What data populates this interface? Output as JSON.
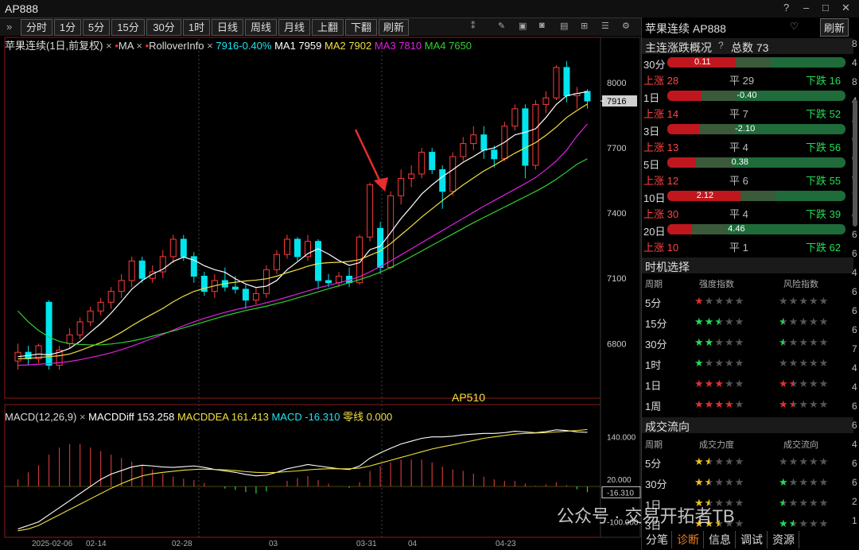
{
  "window": {
    "title": "AP888"
  },
  "toolbar": {
    "buttons": [
      "分时",
      "1分",
      "5分",
      "15分",
      "30分",
      "1时",
      "日线",
      "周线",
      "月线",
      "上翻",
      "下翻",
      "刷新"
    ]
  },
  "legend_main": {
    "name": "苹果连续(1日,前复权)",
    "ma_tag": "MA",
    "rollover_tag": "RolloverInfo",
    "price": "7916-0.40%",
    "ma1": "MA1 7959",
    "ma2": "MA2 7902",
    "ma3": "MA3 7810",
    "ma4": "MA4 7650"
  },
  "legend_macd": {
    "name": "MACD(12,26,9)",
    "diff": "MACDDiff 153.258",
    "dea": "MACDDEA 161.413",
    "macd": "MACD -16.310",
    "zero": "零线 0.000"
  },
  "contract_label": "AP510",
  "price_axis": [
    "8000",
    "7916",
    "7700",
    "7400",
    "7100",
    "6800"
  ],
  "macd_axis": [
    "140.000",
    "20.000",
    "-16.310",
    "-100.000"
  ],
  "date_axis": [
    "2025-02-06",
    "02-14",
    "02-28",
    "03",
    "03-31",
    "04",
    "04-23"
  ],
  "colors": {
    "up": "#ff3b3b",
    "down": "#00e5ee",
    "ma1": "#ffffff",
    "ma2": "#f0e040",
    "ma3": "#e020e0",
    "ma4": "#30d030"
  },
  "chart_data": {
    "type": "candlestick",
    "candles": [
      [
        6720,
        6800,
        6680,
        6760
      ],
      [
        6760,
        6790,
        6700,
        6730
      ],
      [
        6730,
        6800,
        6710,
        6790
      ],
      [
        6990,
        7000,
        6680,
        6700
      ],
      [
        6700,
        6790,
        6680,
        6770
      ],
      [
        6800,
        6870,
        6780,
        6840
      ],
      [
        6840,
        6920,
        6820,
        6900
      ],
      [
        6900,
        6970,
        6880,
        6950
      ],
      [
        6950,
        7010,
        6930,
        6990
      ],
      [
        6990,
        7060,
        6960,
        7040
      ],
      [
        7040,
        7120,
        7010,
        7090
      ],
      [
        7090,
        7200,
        7060,
        7180
      ],
      [
        7180,
        7200,
        7080,
        7100
      ],
      [
        7100,
        7160,
        7080,
        7130
      ],
      [
        7130,
        7230,
        7100,
        7200
      ],
      [
        7200,
        7300,
        7170,
        7280
      ],
      [
        7280,
        7300,
        7180,
        7200
      ],
      [
        7200,
        7220,
        7080,
        7110
      ],
      [
        7110,
        7130,
        7020,
        7040
      ],
      [
        7040,
        7120,
        7010,
        7090
      ],
      [
        7090,
        7150,
        7040,
        7060
      ],
      [
        7060,
        7110,
        7030,
        7050
      ],
      [
        7050,
        7070,
        6960,
        7000
      ],
      [
        7000,
        7060,
        6980,
        7030
      ],
      [
        7030,
        7160,
        7010,
        7140
      ],
      [
        7140,
        7230,
        7120,
        7210
      ],
      [
        7210,
        7300,
        7190,
        7280
      ],
      [
        7280,
        7290,
        7180,
        7200
      ],
      [
        7200,
        7300,
        7180,
        7270
      ],
      [
        7270,
        7280,
        7050,
        7090
      ],
      [
        7090,
        7120,
        7060,
        7080
      ],
      [
        7080,
        7130,
        7060,
        7110
      ],
      [
        7110,
        7150,
        7060,
        7080
      ],
      [
        7080,
        7300,
        7070,
        7290
      ],
      [
        7290,
        7540,
        7270,
        7530
      ],
      [
        7330,
        7360,
        7120,
        7150
      ],
      [
        7150,
        7500,
        7140,
        7480
      ],
      [
        7480,
        7600,
        7440,
        7560
      ],
      [
        7560,
        7620,
        7520,
        7580
      ],
      [
        7580,
        7700,
        7560,
        7680
      ],
      [
        7680,
        7700,
        7580,
        7600
      ],
      [
        7600,
        7620,
        7420,
        7500
      ],
      [
        7500,
        7680,
        7480,
        7660
      ],
      [
        7660,
        7750,
        7640,
        7720
      ],
      [
        7720,
        7800,
        7690,
        7760
      ],
      [
        7760,
        7800,
        7650,
        7690
      ],
      [
        7690,
        7710,
        7610,
        7650
      ],
      [
        7650,
        7820,
        7640,
        7800
      ],
      [
        7800,
        7900,
        7780,
        7880
      ],
      [
        7880,
        7900,
        7560,
        7620
      ],
      [
        7620,
        7920,
        7600,
        7900
      ],
      [
        7900,
        7960,
        7860,
        7930
      ],
      [
        7930,
        8080,
        7920,
        8070
      ],
      [
        8070,
        8100,
        7910,
        7940
      ],
      [
        7940,
        7980,
        7880,
        7950
      ],
      [
        7960,
        7970,
        7880,
        7916
      ]
    ],
    "ma": {
      "ma1": [
        6740,
        6745,
        6752,
        6748,
        6760,
        6778,
        6810,
        6852,
        6892,
        6940,
        6994,
        7050,
        7090,
        7120,
        7142,
        7178,
        7198,
        7184,
        7158,
        7140,
        7128,
        7098,
        7074,
        7058,
        7064,
        7090,
        7140,
        7176,
        7214,
        7236,
        7212,
        7182,
        7160,
        7172,
        7232,
        7248,
        7310,
        7375,
        7430,
        7488,
        7530,
        7568,
        7600,
        7634,
        7660,
        7690,
        7700,
        7726,
        7760,
        7772,
        7788,
        7840,
        7900,
        7940,
        7950,
        7959
      ],
      "ma2": [
        6730,
        6732,
        6736,
        6740,
        6744,
        6752,
        6768,
        6786,
        6804,
        6826,
        6852,
        6882,
        6910,
        6936,
        6962,
        6992,
        7018,
        7040,
        7054,
        7066,
        7076,
        7082,
        7088,
        7092,
        7098,
        7110,
        7126,
        7140,
        7156,
        7168,
        7172,
        7174,
        7178,
        7186,
        7206,
        7226,
        7260,
        7300,
        7340,
        7382,
        7420,
        7458,
        7494,
        7530,
        7562,
        7594,
        7620,
        7648,
        7676,
        7700,
        7724,
        7758,
        7796,
        7840,
        7872,
        7902
      ],
      "ma3": [
        6700,
        6702,
        6705,
        6708,
        6712,
        6718,
        6726,
        6736,
        6746,
        6758,
        6772,
        6788,
        6806,
        6824,
        6842,
        6862,
        6882,
        6900,
        6916,
        6930,
        6944,
        6956,
        6966,
        6976,
        6988,
        7000,
        7014,
        7028,
        7042,
        7056,
        7068,
        7080,
        7092,
        7108,
        7130,
        7154,
        7180,
        7208,
        7236,
        7264,
        7292,
        7320,
        7348,
        7376,
        7404,
        7432,
        7458,
        7484,
        7510,
        7536,
        7564,
        7600,
        7640,
        7690,
        7755,
        7810
      ],
      "ma4": [
        6950,
        6900,
        6860,
        6830,
        6810,
        6800,
        6796,
        6794,
        6794,
        6798,
        6804,
        6812,
        6822,
        6834,
        6846,
        6858,
        6872,
        6886,
        6900,
        6914,
        6928,
        6940,
        6952,
        6962,
        6972,
        6984,
        6996,
        7010,
        7024,
        7038,
        7052,
        7066,
        7080,
        7094,
        7110,
        7128,
        7150,
        7174,
        7200,
        7226,
        7252,
        7278,
        7304,
        7330,
        7356,
        7380,
        7404,
        7428,
        7452,
        7476,
        7500,
        7526,
        7556,
        7590,
        7625,
        7650
      ]
    },
    "macd_series": {
      "diff": [
        -120,
        -110,
        -100,
        -80,
        -60,
        -40,
        -20,
        0,
        20,
        35,
        45,
        55,
        60,
        58,
        55,
        54,
        56,
        58,
        54,
        48,
        44,
        40,
        34,
        30,
        32,
        40,
        50,
        56,
        62,
        58,
        54,
        50,
        48,
        58,
        80,
        95,
        108,
        120,
        128,
        136,
        140,
        140,
        142,
        146,
        148,
        150,
        150,
        152,
        156,
        154,
        152,
        155,
        160,
        158,
        154,
        153
      ],
      "dea": [
        -125,
        -120,
        -110,
        -95,
        -80,
        -65,
        -50,
        -35,
        -20,
        -5,
        8,
        20,
        30,
        36,
        40,
        43,
        46,
        48,
        49,
        48,
        47,
        45,
        42,
        40,
        39,
        40,
        42,
        44,
        47,
        49,
        50,
        50,
        50,
        52,
        58,
        66,
        74,
        82,
        90,
        98,
        106,
        112,
        118,
        124,
        130,
        136,
        140,
        144,
        148,
        150,
        151,
        152,
        154,
        156,
        158,
        161
      ],
      "bar": [
        20,
        40,
        60,
        90,
        110,
        120,
        120,
        110,
        100,
        90,
        80,
        70,
        60,
        48,
        36,
        28,
        22,
        18,
        10,
        0,
        -6,
        -10,
        -16,
        -20,
        -14,
        0,
        16,
        24,
        30,
        18,
        8,
        0,
        -4,
        12,
        44,
        58,
        68,
        76,
        76,
        76,
        68,
        56,
        48,
        44,
        36,
        28,
        20,
        16,
        16,
        8,
        2,
        6,
        12,
        4,
        -8,
        -16
      ]
    },
    "price_range": [
      6600,
      8150
    ],
    "macd_range": [
      -130,
      200
    ]
  },
  "right": {
    "header": "苹果连续 AP888",
    "refresh": "刷新",
    "section1_title": "主连涨跌概况",
    "section1_total": "总数 73",
    "rows": [
      {
        "period": "30分",
        "val": "0.11",
        "up": "上涨 28",
        "flat": "平 29",
        "down": "下跌 16",
        "red": 0.38
      },
      {
        "period": "1日",
        "val": "-0.40",
        "up": "上涨 14",
        "flat": "平 7",
        "down": "下跌 52",
        "red": 0.19
      },
      {
        "period": "3日",
        "val": "-2.10",
        "up": "上涨 13",
        "flat": "平 4",
        "down": "下跌 56",
        "red": 0.18
      },
      {
        "period": "5日",
        "val": "0.38",
        "up": "上涨 12",
        "flat": "平 6",
        "down": "下跌 55",
        "red": 0.16
      },
      {
        "period": "10日",
        "val": "2.12",
        "up": "上涨 30",
        "flat": "平 4",
        "down": "下跌 39",
        "red": 0.41
      },
      {
        "period": "20日",
        "val": "4.46",
        "up": "上涨 10",
        "flat": "平 1",
        "down": "下跌 62",
        "red": 0.14
      }
    ],
    "section2_title": "时机选择",
    "section2_cols": [
      "周期",
      "强度指数",
      "风险指数"
    ],
    "timing": [
      {
        "period": "5分",
        "strength": 1,
        "risk": 0
      },
      {
        "period": "15分",
        "strength": 2.5,
        "risk": 0.5
      },
      {
        "period": "30分",
        "strength": 2,
        "risk": 0.5
      },
      {
        "period": "1时",
        "strength": 1,
        "risk": 0
      },
      {
        "period": "1日",
        "strength": 3,
        "risk": 1.5
      },
      {
        "period": "1周",
        "strength": 4,
        "risk": 1.5
      }
    ],
    "section3_title": "成交流向",
    "section3_cols": [
      "周期",
      "成交力度",
      "成交流向"
    ],
    "flow": [
      {
        "period": "5分",
        "strength": 1.5,
        "flow": 0
      },
      {
        "period": "30分",
        "strength": 1.5,
        "flow": 1
      },
      {
        "period": "1日",
        "strength": 1.5,
        "flow": 0.5
      },
      {
        "period": "3日",
        "strength": 2.5,
        "flow": 1.5
      }
    ],
    "tabs": [
      "分笔",
      "诊断",
      "信息",
      "调试",
      "资源"
    ],
    "right_edge_digits": [
      "8",
      "4",
      "8",
      "4",
      "8",
      "6",
      "6",
      "6",
      "7",
      "6",
      "6",
      "6",
      "4",
      "6",
      "6",
      "6",
      "7",
      "4",
      "4",
      "6",
      "6",
      "4",
      "6",
      "6",
      "2",
      "1"
    ]
  },
  "watermark": "公众号 · 交易开拓者TB"
}
